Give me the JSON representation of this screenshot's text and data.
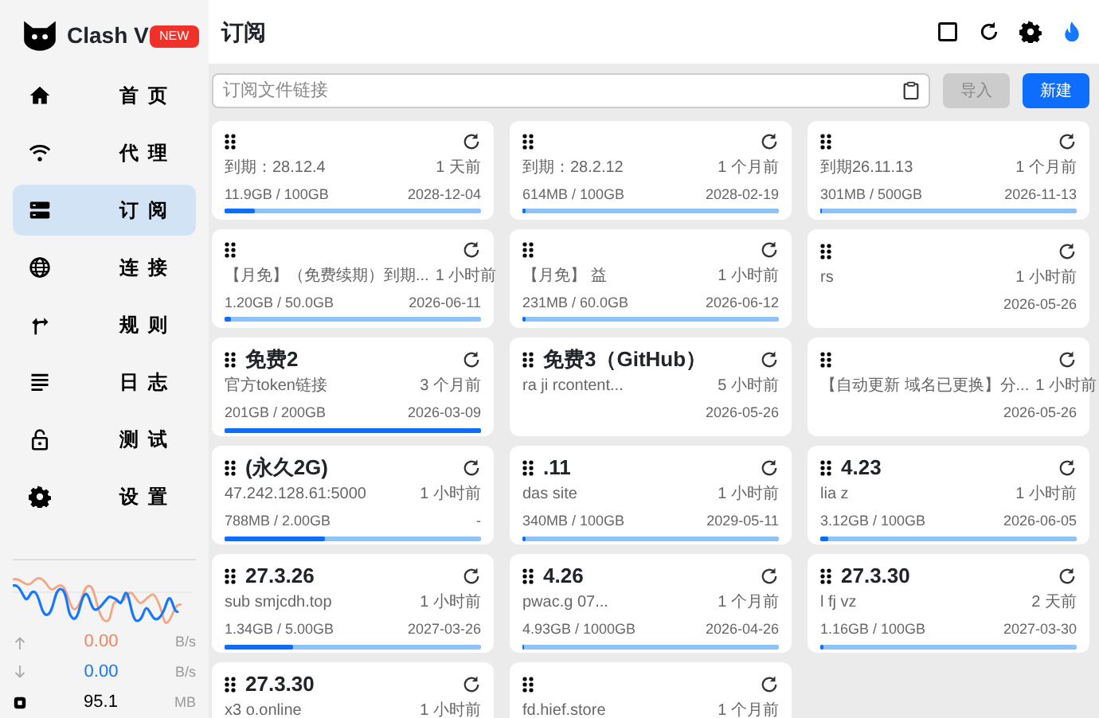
{
  "app": {
    "title": "Clash V",
    "badge": "NEW"
  },
  "nav": [
    {
      "label": "首页",
      "selected": false
    },
    {
      "label": "代理",
      "selected": false
    },
    {
      "label": "订阅",
      "selected": true
    },
    {
      "label": "连接",
      "selected": false
    },
    {
      "label": "规则",
      "selected": false
    },
    {
      "label": "日志",
      "selected": false
    },
    {
      "label": "测试",
      "selected": false
    },
    {
      "label": "设置",
      "selected": false
    }
  ],
  "traffic": {
    "upload": "0.00",
    "upload_unit": "B/s",
    "download": "0.00",
    "download_unit": "B/s",
    "memory": "95.1",
    "memory_unit": "MB"
  },
  "page_title": "订阅",
  "import_bar": {
    "placeholder": "订阅文件链接",
    "import_button": "导入",
    "new_button": "新建"
  },
  "profiles": [
    {
      "subtitle": "到期：28.12.4",
      "updated": "1 天前",
      "usage": "11.9GB / 100GB",
      "expires": "2028-12-04",
      "level": 0.119,
      "selected": false
    },
    {
      "subtitle": "到期：28.2.12",
      "updated": "1 个月前",
      "usage": "614MB / 100GB",
      "expires": "2028-02-19",
      "level": 0.015,
      "selected": false
    },
    {
      "subtitle": "到期26.11.13",
      "updated": "1 个月前",
      "usage": "301MB / 500GB",
      "expires": "2026-11-13",
      "level": 0.006,
      "selected": false
    },
    {
      "subtitle": "【月免】（免费续期）到期...",
      "updated": "1 小时前",
      "usage": "1.20GB / 50.0GB",
      "expires": "2026-06-11",
      "level": 0.024,
      "selected": false
    },
    {
      "subtitle": "【月免】 益",
      "updated": "1 小时前",
      "usage": "231MB / 60.0GB",
      "expires": "2026-06-12",
      "level": 0.012,
      "selected": false
    },
    {
      "subtitle": "rs",
      "updated": "1 小时前",
      "expires": "2026-05-26",
      "selected": false
    },
    {
      "name": "免费2",
      "subtitle": "官方token链接",
      "updated": "3 个月前",
      "usage": "201GB / 200GB",
      "expires": "2026-03-09",
      "level": 1,
      "selected": false
    },
    {
      "name": "免费3（GitHub）",
      "subtitle": "ra  ji  rcontent...",
      "updated": "5 小时前",
      "expires": "2026-05-26",
      "selected": false
    },
    {
      "subtitle": "【自动更新 域名已更换】分...",
      "updated": "1 小时前",
      "expires": "2026-05-26",
      "selected": false
    },
    {
      "name": "(永久2G)",
      "subtitle": "47.242.128.61:5000",
      "updated": "1 小时前",
      "usage": "788MB / 2.00GB",
      "expires": "-",
      "level": 0.39,
      "selected": false
    },
    {
      "name": ".11",
      "subtitle": "das  site",
      "updated": "1 小时前",
      "usage": "340MB / 100GB",
      "expires": "2029-05-11",
      "level": 0.01,
      "selected": false
    },
    {
      "name": "4.23",
      "subtitle": "lia  z",
      "updated": "1 小时前",
      "usage": "3.12GB / 100GB",
      "expires": "2026-06-05",
      "level": 0.031,
      "selected": false
    },
    {
      "name": "27.3.26",
      "subtitle": "sub  smjcdh.top",
      "updated": "1 小时前",
      "usage": "1.34GB / 5.00GB",
      "expires": "2027-03-26",
      "level": 0.27,
      "selected": false
    },
    {
      "name": "4.26",
      "subtitle": "pwac.g  07...",
      "updated": "1 个月前",
      "usage": "4.93GB / 1000GB",
      "expires": "2026-04-26",
      "level": 0.005,
      "selected": false
    },
    {
      "name": "27.3.30",
      "subtitle": "l  fj  vz",
      "updated": "2 天前",
      "usage": "1.16GB / 100GB",
      "expires": "2027-03-30",
      "level": 0.012,
      "selected": false
    },
    {
      "name": "27.3.30",
      "subtitle": "x3  o.online",
      "updated": "1 小时前",
      "selected": false
    },
    {
      "subtitle": "fd.hief.store",
      "updated": "1 个月前",
      "selected": false
    }
  ]
}
